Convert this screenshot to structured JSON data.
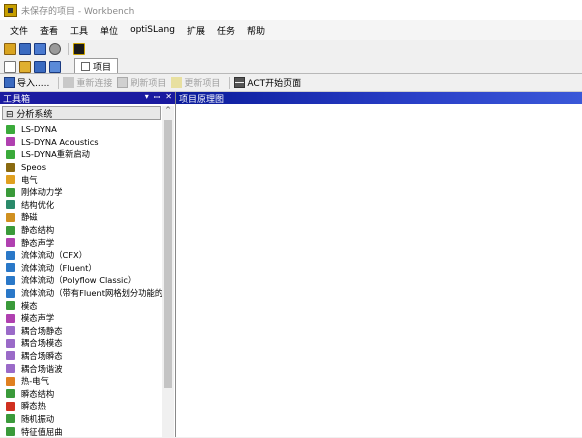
{
  "window": {
    "title": "未保存的项目 - Workbench"
  },
  "menubar": {
    "items": [
      "文件",
      "查看",
      "工具",
      "单位",
      "optiSLang",
      "扩展",
      "任务",
      "帮助"
    ]
  },
  "tabs": [
    {
      "label": "项目"
    }
  ],
  "toolbar2": {
    "import": "导入.....",
    "reconnect": "重新连接",
    "refresh": "刷新项目",
    "update": "更新项目",
    "act_start": "ACT开始页面"
  },
  "toolbox": {
    "title": "工具箱",
    "controls": {
      "dropdown": "▾",
      "pin": "ꟷ",
      "close": "✕"
    },
    "group": "⊟ 分析系统",
    "items": [
      {
        "label": "LS-DYNA",
        "color": "#3aaa3a"
      },
      {
        "label": "LS-DYNA Acoustics",
        "color": "#b040b0"
      },
      {
        "label": "LS-DYNA重新启动",
        "color": "#3aaa3a"
      },
      {
        "label": "Speos",
        "color": "#8a6a10"
      },
      {
        "label": "电气",
        "color": "#e0a020"
      },
      {
        "label": "刚体动力学",
        "color": "#3a9a3a"
      },
      {
        "label": "结构优化",
        "color": "#2a8a6a"
      },
      {
        "label": "静磁",
        "color": "#d09020"
      },
      {
        "label": "静态结构",
        "color": "#3a9a3a"
      },
      {
        "label": "静态声学",
        "color": "#b040b0"
      },
      {
        "label": "流体流动（CFX）",
        "color": "#2a78c8"
      },
      {
        "label": "流体流动（Fluent）",
        "color": "#2a78c8"
      },
      {
        "label": "流体流动（Polyflow Classic）",
        "color": "#2a78c8"
      },
      {
        "label": "流体流动（带有Fluent网格划分功能的",
        "color": "#2a78c8"
      },
      {
        "label": "模态",
        "color": "#3a9a3a"
      },
      {
        "label": "模态声学",
        "color": "#b040b0"
      },
      {
        "label": "耦合场静态",
        "color": "#9a6ac8"
      },
      {
        "label": "耦合场模态",
        "color": "#9a6ac8"
      },
      {
        "label": "耦合场瞬态",
        "color": "#9a6ac8"
      },
      {
        "label": "耦合场谐波",
        "color": "#9a6ac8"
      },
      {
        "label": "热-电气",
        "color": "#e08020"
      },
      {
        "label": "瞬态结构",
        "color": "#3a9a3a"
      },
      {
        "label": "瞬态热",
        "color": "#d03020"
      },
      {
        "label": "随机振动",
        "color": "#3a9a3a"
      },
      {
        "label": "特征值屈曲",
        "color": "#3a9a3a"
      }
    ]
  },
  "schematic": {
    "title": "项目原理图"
  }
}
